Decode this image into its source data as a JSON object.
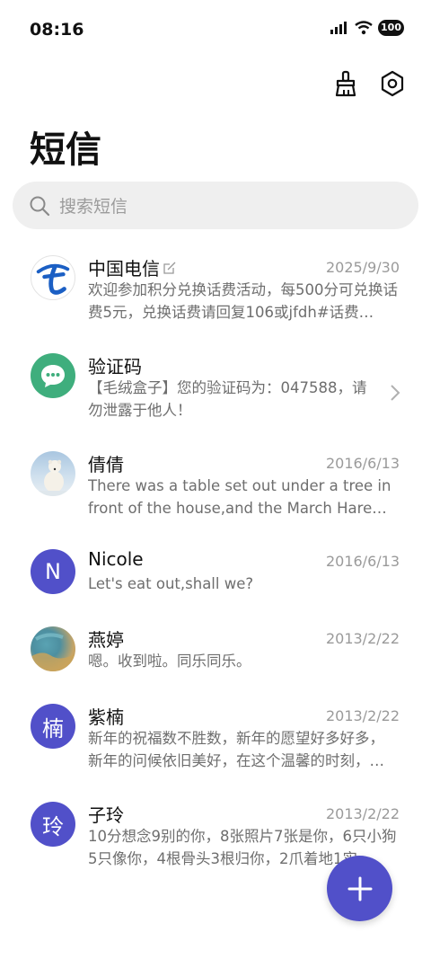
{
  "status": {
    "time": "08:16",
    "battery": "100"
  },
  "header": {
    "title": "短信"
  },
  "search": {
    "placeholder": "搜索短信"
  },
  "colors": {
    "accent": "#5150c9",
    "green": "#3fae7d",
    "telecom_blue": "#1b5fc4"
  },
  "conversations": [
    {
      "name": "中国电信",
      "date": "2025/9/30",
      "preview": "欢迎参加积分兑换话费活动，每500分可兑换话费5元，兑换话费请回复106或jfdh#话费…",
      "avatar_icon": "china-telecom-logo-icon"
    },
    {
      "name": "验证码",
      "date": "",
      "preview": "【毛绒盒子】您的验证码为：047588，请勿泄露于他人！",
      "avatar_icon": "message-bubble-icon"
    },
    {
      "name": "倩倩",
      "date": "2016/6/13",
      "preview": "There was a table set out under a tree in front of the house,and the March Hare an…",
      "avatar_icon": "polar-bear-photo"
    },
    {
      "name": "Nicole",
      "date": "2016/6/13",
      "preview": "Let's eat out,shall we?",
      "avatar_letter": "N"
    },
    {
      "name": "燕婷",
      "date": "2013/2/22",
      "preview": "嗯。收到啦。同乐同乐。",
      "avatar_icon": "landscape-photo"
    },
    {
      "name": "紫楠",
      "date": "2013/2/22",
      "preview": "新年的祝福数不胜数，新年的愿望好多好多，新年的问候依旧美好，在这个温馨的时刻，…",
      "avatar_letter": "楠"
    },
    {
      "name": "子玲",
      "date": "2013/2/22",
      "preview": "10分想念9别的你，8张照片7张是你，6只小狗5只像你，4根骨头3根归你，2爪着地1实…",
      "avatar_letter": "玲"
    }
  ]
}
